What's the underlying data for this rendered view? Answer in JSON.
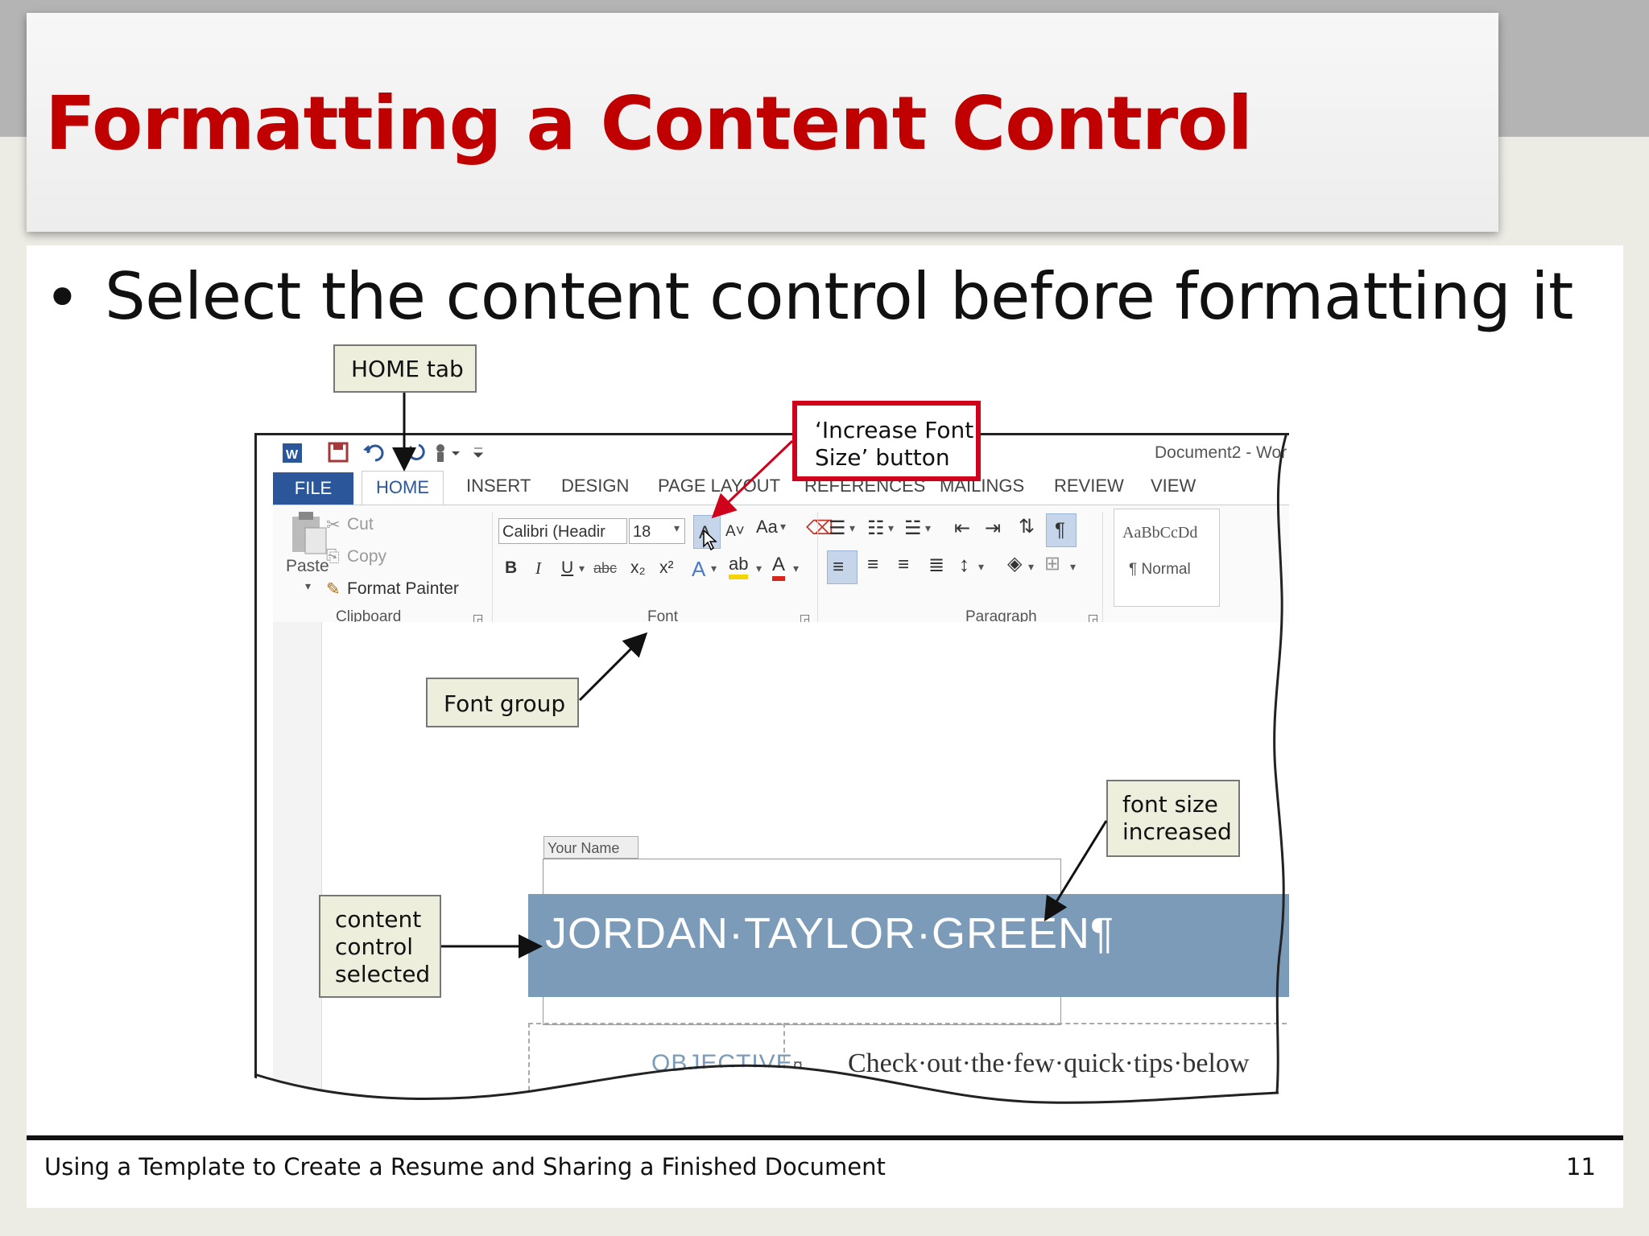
{
  "slide": {
    "title": "Formatting a Content Control",
    "bullet": "Select the content control before formatting it",
    "footer": "Using a Template to Create a Resume and Sharing a Finished Document",
    "page_number": "11"
  },
  "word": {
    "window_title": "Document2 - Wor",
    "tabs": [
      "FILE",
      "HOME",
      "INSERT",
      "DESIGN",
      "PAGE LAYOUT",
      "REFERENCES",
      "MAILINGS",
      "REVIEW",
      "VIEW"
    ],
    "clipboard": {
      "paste": "Paste",
      "cut": "Cut",
      "copy": "Copy",
      "format_painter": "Format Painter",
      "group_label": "Clipboard"
    },
    "font": {
      "font_name": "Calibri (Headir",
      "font_size": "18",
      "group_label": "Font",
      "change_case": "Aa"
    },
    "paragraph": {
      "group_label": "Paragraph"
    },
    "styles": {
      "preview": "AaBbCcDd",
      "normal": "¶ Normal"
    },
    "document": {
      "content_control_tag": "Your Name",
      "name": "JORDAN·TAYLOR·GREEN",
      "pilcrow": "¶",
      "objective": "OBJECTIVE",
      "objective_mark": "¤",
      "body_text": "Check·out·the·few·quick·tips·below"
    }
  },
  "callouts": {
    "home_tab": "HOME tab",
    "increase_font": "‘Increase Font Size’ button",
    "font_group": "Font group",
    "font_size_increased": "font size increased",
    "content_control_selected": "content control selected"
  },
  "colors": {
    "title_red": "#c00000",
    "file_tab_blue": "#2b579a",
    "name_bar": "#7b9bb8",
    "callout_highlight": "#d0021b"
  }
}
